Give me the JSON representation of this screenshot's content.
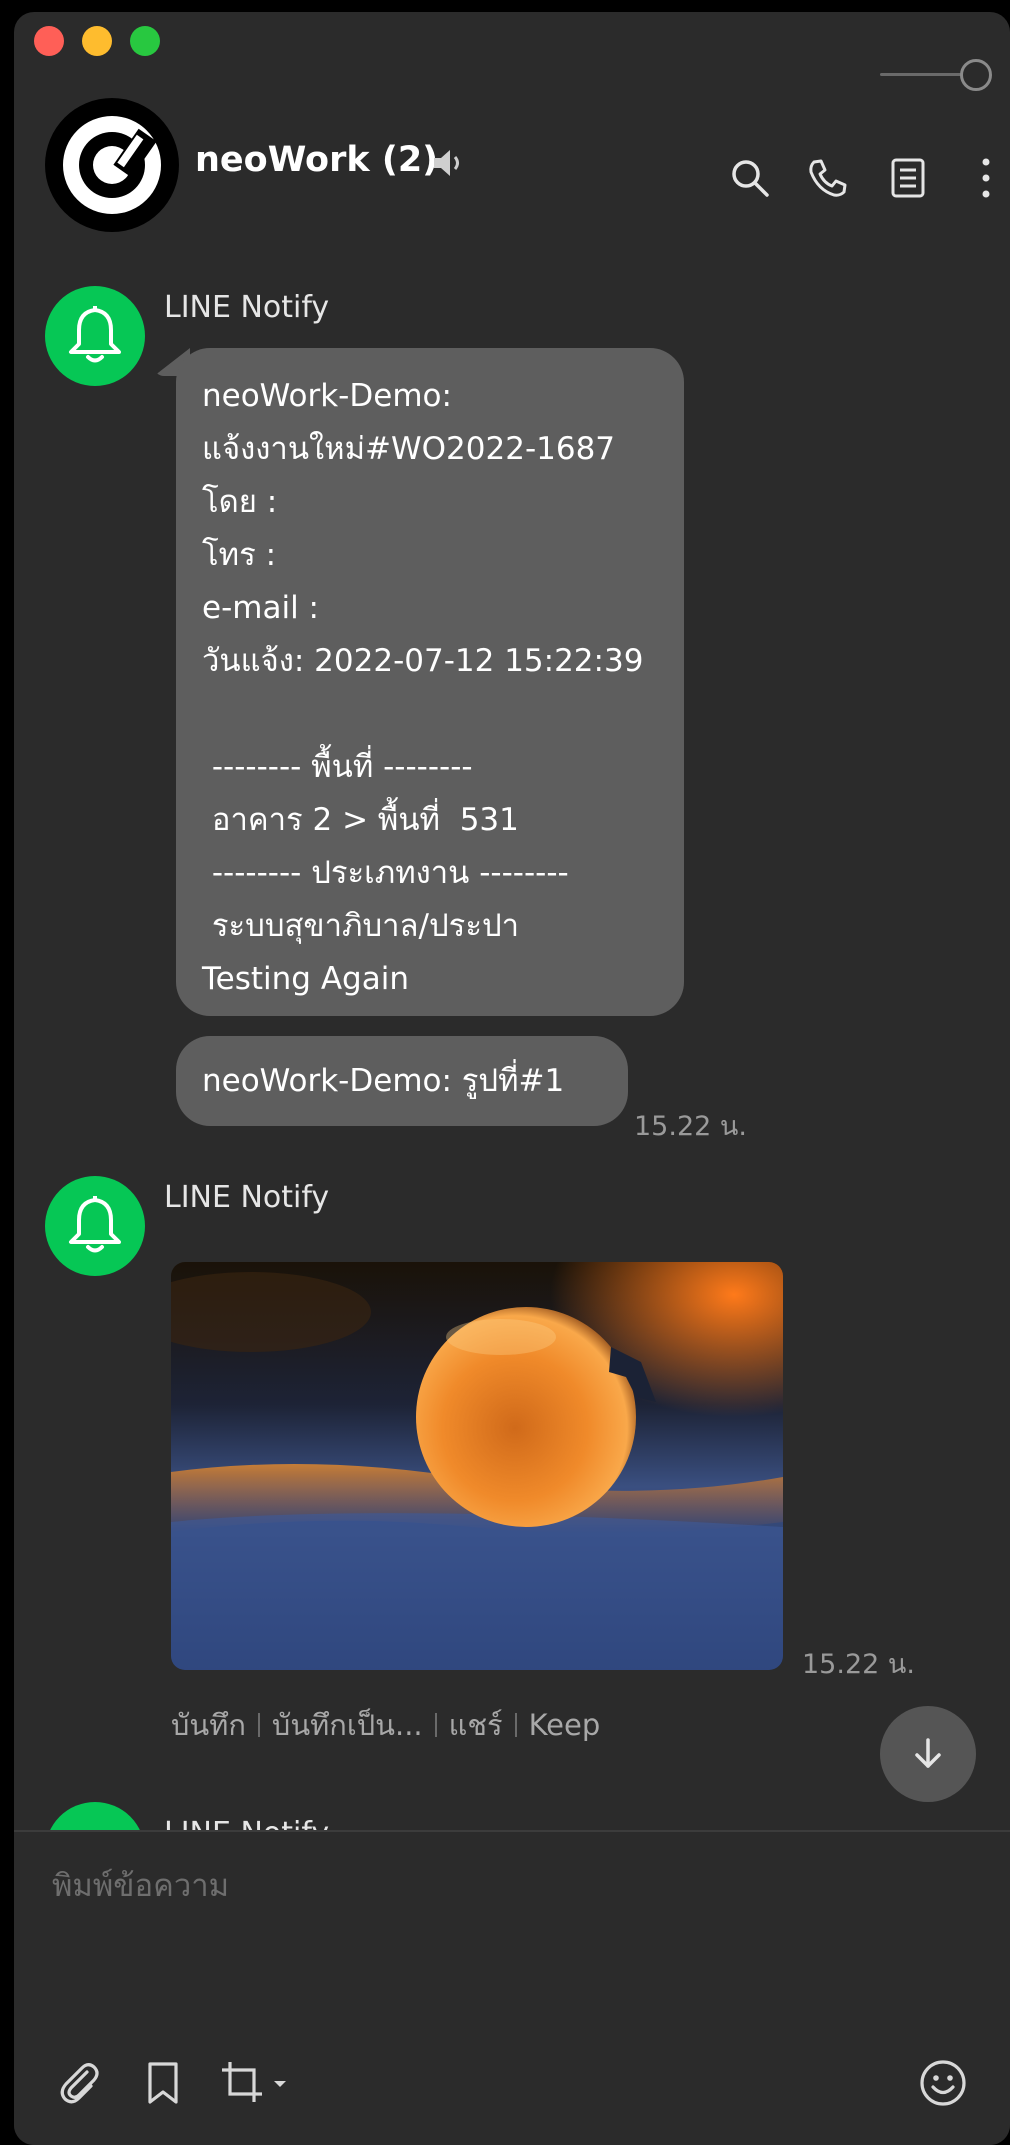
{
  "header": {
    "title": "neoWork (2)"
  },
  "messages": [
    {
      "sender": "LINE Notify",
      "lines": [
        "neoWork-Demo:",
        "แจ้งงานใหม่#WO2022-1687",
        "โดย :",
        "โทร :",
        "e-mail :",
        "วันแจ้ง: 2022-07-12 15:22:39",
        "",
        " -------- พื้นที่ --------",
        " อาคาร 2 > พื้นที่  531",
        " -------- ประเภทงาน --------",
        " ระบบสุขาภิบาล/ประปา",
        "Testing Again"
      ],
      "second_text": "neoWork-Demo: รูปที่#1",
      "time": "15.22 น."
    },
    {
      "sender": "LINE Notify",
      "image_alt": "frozen bubble photo",
      "time": "15.22 น.",
      "actions": [
        "บันทึก",
        "บันทึกเป็น...",
        "แชร์",
        "Keep"
      ]
    },
    {
      "sender": "LINE Notify"
    }
  ],
  "composer": {
    "placeholder": "พิมพ์ข้อความ"
  },
  "icons": [
    "search-icon",
    "phone-icon",
    "notes-icon",
    "more-icon",
    "volume-icon",
    "bell-icon",
    "arrow-down-icon",
    "attach-icon",
    "bookmark-icon",
    "crop-icon",
    "emoji-icon"
  ],
  "colors": {
    "background": "#2b2b2b",
    "bubble": "#5e5e5e",
    "line_green": "#06c755"
  }
}
